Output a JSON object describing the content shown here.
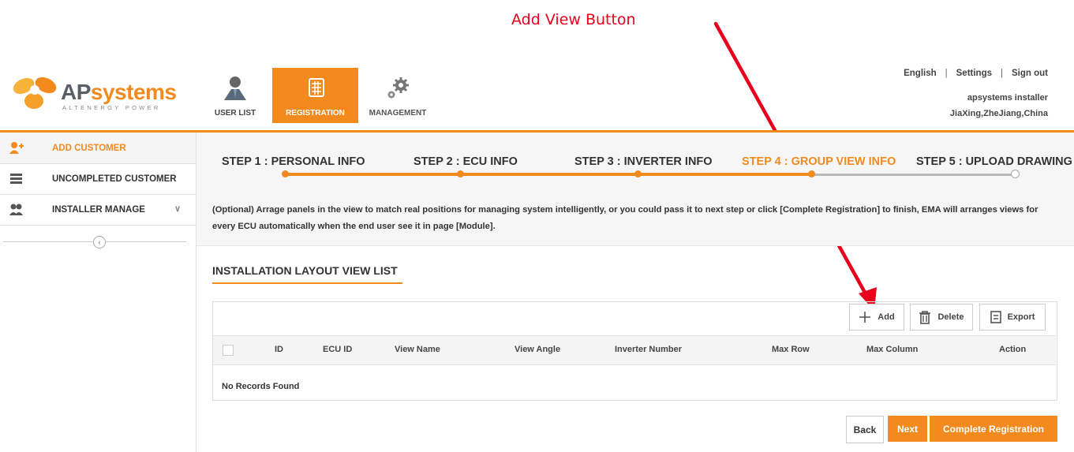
{
  "annotation": {
    "label": "Add View Button",
    "color": "#e8001c"
  },
  "brand": {
    "name_part1": "AP",
    "name_part2": "systems",
    "tagline": "ALTENERGY POWER",
    "accent": "#f28a1e"
  },
  "nav": {
    "tabs": [
      {
        "label": "USER LIST",
        "icon": "user-icon"
      },
      {
        "label": "REGISTRATION",
        "icon": "grid-icon",
        "active": true
      },
      {
        "label": "MANAGEMENT",
        "icon": "gears-icon"
      }
    ]
  },
  "top_links": {
    "language": "English",
    "sep": "|",
    "settings": "Settings",
    "sign_out": "Sign out"
  },
  "user": {
    "name": "apsystems installer",
    "location": "JiaXing,ZheJiang,China"
  },
  "sidebar": {
    "items": [
      {
        "label": "ADD CUSTOMER",
        "icon": "add-user-icon",
        "active": true
      },
      {
        "label": "UNCOMPLETED CUSTOMER",
        "icon": "list-icon"
      },
      {
        "label": "INSTALLER MANAGE",
        "icon": "users-icon",
        "chevron": "chevron-down-icon"
      }
    ],
    "collapse_glyph": "‹"
  },
  "steps": [
    {
      "label": "STEP 1 : PERSONAL INFO",
      "done": true
    },
    {
      "label": "STEP 2 : ECU INFO",
      "done": true
    },
    {
      "label": "STEP 3 : INVERTER INFO",
      "done": true
    },
    {
      "label": "STEP 4 : GROUP VIEW INFO",
      "active": true
    },
    {
      "label": "STEP 5 : UPLOAD DRAWING",
      "done": false
    }
  ],
  "description": "(Optional) Arrage panels in the view to match real positions for managing system intelligently, or you could pass it to next step or click [Complete Registration] to finish, EMA will arranges views for every ECU automatically when the end user see it in page [Module].",
  "section": {
    "title": "INSTALLATION LAYOUT VIEW LIST"
  },
  "toolbar": {
    "add": "Add",
    "delete": "Delete",
    "export": "Export"
  },
  "table": {
    "columns": [
      "ID",
      "ECU ID",
      "View Name",
      "View Angle",
      "Inverter Number",
      "Max Row",
      "Max Column",
      "Action"
    ],
    "empty": "No Records Found"
  },
  "footer": {
    "back": "Back",
    "next": "Next",
    "complete": "Complete Registration"
  }
}
